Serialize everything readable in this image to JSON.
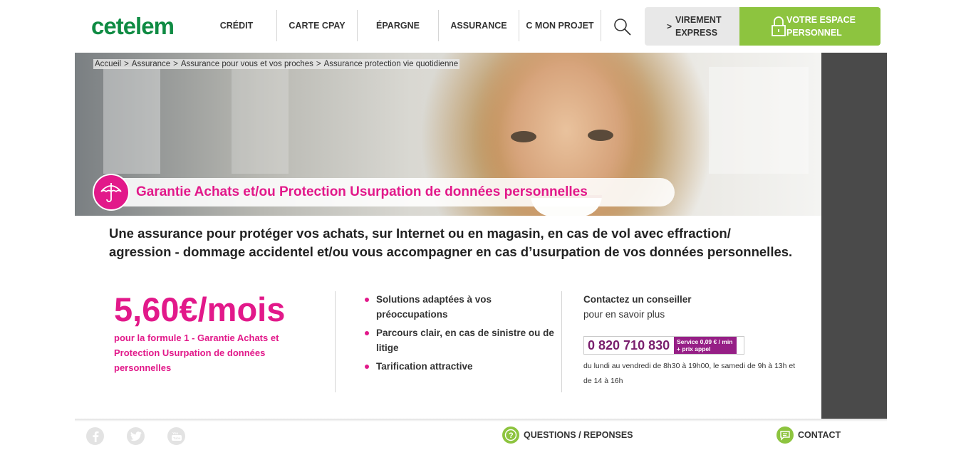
{
  "brand": {
    "logo_text": "cetelem",
    "green": "#0f8b43",
    "pink": "#e2198a",
    "lime": "#8dc43f"
  },
  "nav": {
    "items": [
      {
        "label": "CRÉDIT"
      },
      {
        "label": "CARTE CPAY"
      },
      {
        "label": "ÉPARGNE"
      },
      {
        "label": "ASSURANCE"
      },
      {
        "label": "C MON PROJET"
      }
    ],
    "search_icon": "search-icon",
    "virement": {
      "chevron": ">",
      "label_line1": "VIREMENT",
      "label_line2": "EXPRESS"
    },
    "espace": {
      "label_line1": "VOTRE ESPACE",
      "label_line2": "PERSONNEL",
      "icon": "lock-icon"
    }
  },
  "breadcrumb": [
    "Accueil",
    "Assurance",
    "Assurance pour vous et vos proches",
    "Assurance protection vie quotidienne"
  ],
  "breadcrumb_sep": ">",
  "hero": {
    "title": "Garantie Achats et/ou Protection Usurpation de données personnelles",
    "icon": "umbrella-icon"
  },
  "intro": "Une assurance pour protéger vos achats, sur Internet ou en magasin, en cas de vol avec effraction/ agression - dommage accidentel et/ou vous accompagner en cas d’usurpation de vos données personnelles.",
  "offer": {
    "price": "5,60€/mois",
    "note": "pour la formule 1 - Garantie Achats et Protection Usurpation de données personnelles"
  },
  "benefits": [
    "Solutions adaptées à vos préoccupations",
    "Parcours clair, en cas de sinistre ou de litige",
    "Tarification attractive"
  ],
  "contact": {
    "title": "Contactez un conseiller",
    "subtitle": "pour en savoir plus",
    "phone": "0 820 710 830",
    "service_line1": "Service 0,09 € / min",
    "service_line2": "+ prix appel",
    "hours": "du lundi au vendredi de 8h30 à 19h00, le samedi de 9h à 13h et de 14 à 16h"
  },
  "footer": {
    "social": [
      "facebook-icon",
      "twitter-icon",
      "youtube-icon"
    ],
    "questions": "QUESTIONS / REPONSES",
    "contact": "CONTACT"
  }
}
